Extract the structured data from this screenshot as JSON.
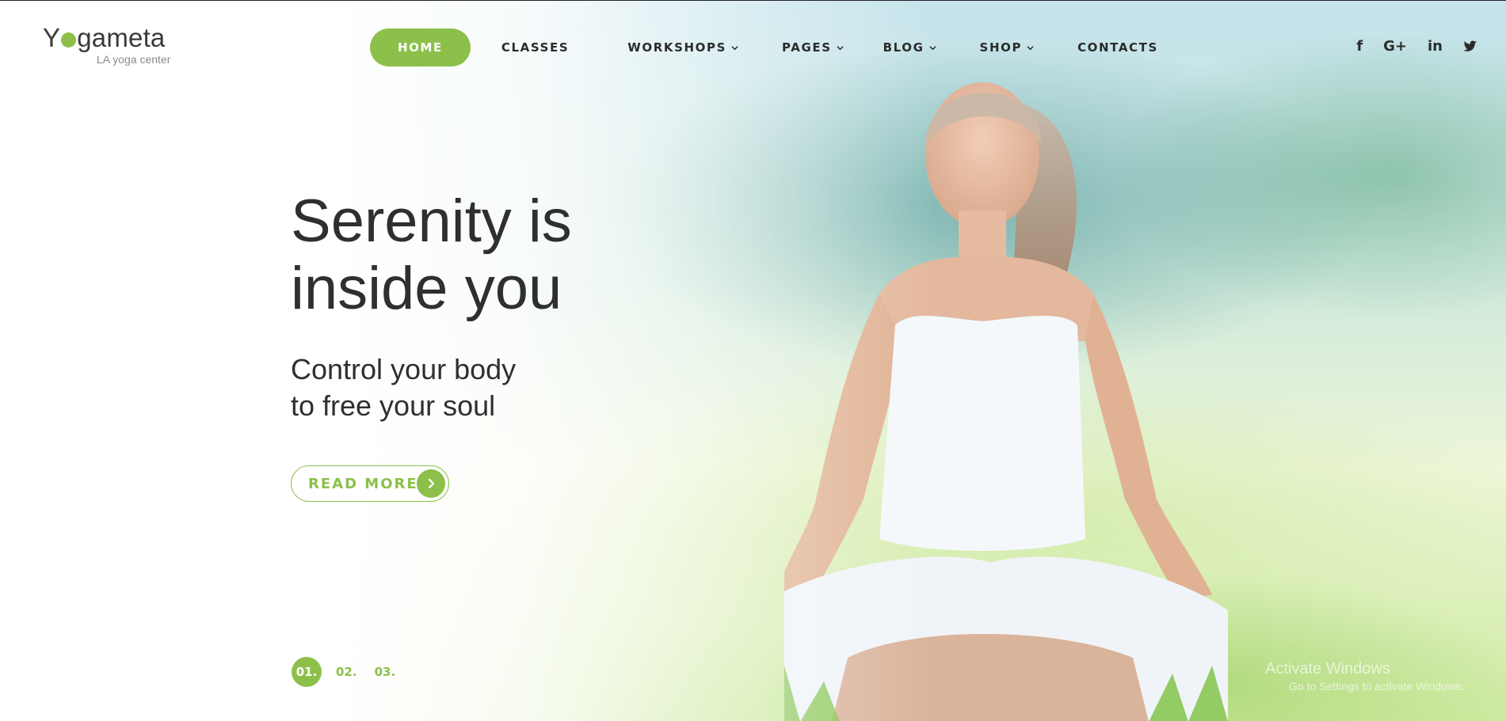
{
  "logo": {
    "name_before": "Y",
    "name_after": "gameta",
    "tagline": "LA yoga center"
  },
  "nav": {
    "items": [
      {
        "label": "HOME",
        "active": true
      },
      {
        "label": "CLASSES"
      },
      {
        "label": "WORKSHOPS",
        "dropdown": true
      },
      {
        "label": "PAGES",
        "dropdown": true
      },
      {
        "label": "BLOG",
        "dropdown": true
      },
      {
        "label": "SHOP",
        "dropdown": true
      },
      {
        "label": "CONTACTS"
      }
    ]
  },
  "social": {
    "facebook": "f",
    "google_plus": "G+",
    "linkedin": "in"
  },
  "hero": {
    "title_line1": "Serenity is",
    "title_line2": "inside you",
    "subtitle_line1": "Control your body",
    "subtitle_line2": "to free your soul",
    "cta_label": "READ MORE"
  },
  "pager": [
    "01.",
    "02.",
    "03."
  ],
  "watermark": {
    "line1": "Activate Windows",
    "line2": "Go to Settings to activate Windows."
  },
  "colors": {
    "accent": "#8cc04b",
    "text": "#2f2f2f"
  },
  "icons": [
    "chevron-down-icon",
    "facebook-icon",
    "google-plus-icon",
    "linkedin-icon",
    "twitter-icon",
    "arrow-right-icon"
  ]
}
